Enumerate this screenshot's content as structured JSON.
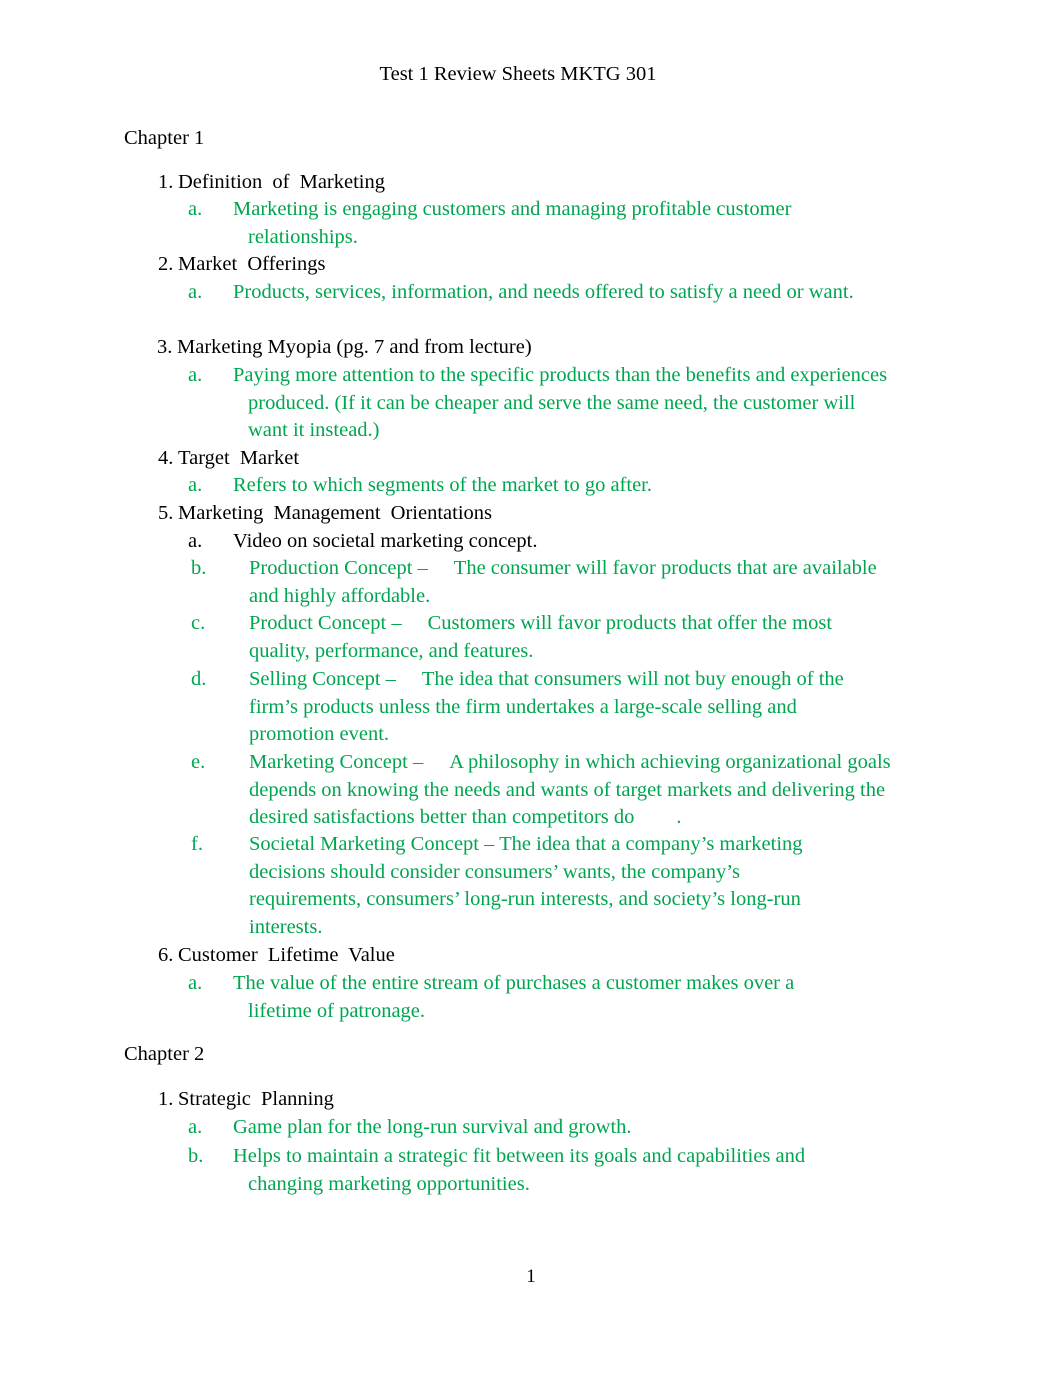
{
  "document": {
    "title": "Test 1 Review Sheets MKTG 301",
    "page_number": "1",
    "accent_green": "#00a550",
    "text_black": "#000000"
  },
  "chapter1": {
    "heading": "Chapter 1",
    "items": [
      {
        "marker": "1.",
        "text": "Definition of Marketing",
        "subs": [
          {
            "marker": "a.",
            "text": "Marketing is engaging customers and managing profitable customer relationships."
          }
        ]
      },
      {
        "marker": "2.",
        "text": "Market Offerings",
        "subs": [
          {
            "marker": "a.",
            "text": "Products, services, information, and needs offered to satisfy a need or want."
          }
        ]
      },
      {
        "marker": "3.",
        "text": "Marketing Myopia (pg. 7 and from lecture)",
        "subs": [
          {
            "marker": "a.",
            "text": "Paying more attention to the specific products than the benefits and experiences produced. (If it can be cheaper and serve the same need, the customer will want it instead.)"
          }
        ]
      },
      {
        "marker": "4.",
        "text": "Target Market",
        "subs": [
          {
            "marker": "a.",
            "text": "Refers to which segments of the market to go after."
          }
        ]
      },
      {
        "marker": "5.",
        "text": "Marketing Management Orientations",
        "subs": [
          {
            "marker": "a.",
            "text": "Video on societal marketing concept."
          },
          {
            "marker": "b.",
            "term": "Production Concept –",
            "text": "The consumer will favor products that are available and highly affordable."
          },
          {
            "marker": "c.",
            "term": "Product Concept –",
            "text": "Customers will favor products that offer the most quality, performance, and features."
          },
          {
            "marker": "d.",
            "term": "Selling Concept –",
            "text": "The idea that consumers will not buy enough of the firm’s products unless the firm undertakes a large-scale selling and promotion event."
          },
          {
            "marker": "e.",
            "term": "Marketing Concept –",
            "text": "A philosophy in which achieving organizational goals depends on knowing the needs and wants of target markets and delivering the desired satisfactions better than competitors do",
            "trailing": "."
          },
          {
            "marker": "f.",
            "text": "Societal Marketing Concept – The idea that a company’s marketing decisions should consider consumers’ wants, the company’s requirements, consumers’ long-run interests, and society’s long-run interests."
          }
        ]
      },
      {
        "marker": "6.",
        "text": "Customer Lifetime Value",
        "subs": [
          {
            "marker": "a.",
            "text": "The value of the entire stream of purchases a customer makes over a lifetime of patronage."
          }
        ]
      }
    ]
  },
  "chapter2": {
    "heading": "Chapter 2",
    "items": [
      {
        "marker": "1.",
        "text": "Strategic Planning",
        "subs": [
          {
            "marker": "a.",
            "text": "Game plan for the long-run survival and growth."
          },
          {
            "marker": "b.",
            "text": "Helps to maintain a strategic fit between its goals and capabilities and changing marketing opportunities."
          }
        ]
      }
    ]
  }
}
